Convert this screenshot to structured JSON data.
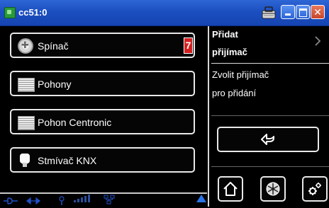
{
  "window": {
    "title": "cc51:0",
    "icons": [
      "app-icon",
      "toolbox-icon",
      "minimize-icon",
      "maximize-icon",
      "close-icon"
    ],
    "close_glyph": "✕"
  },
  "device_list": {
    "items": [
      {
        "label": "Spínač",
        "icon": "switch-icon",
        "badge": "7"
      },
      {
        "label": "Pohony",
        "icon": "blind-icon"
      },
      {
        "label": "Pohon Centronic",
        "icon": "blind-icon"
      },
      {
        "label": "Stmívač KNX",
        "icon": "bulb-icon"
      }
    ]
  },
  "status_bar": {
    "icons": [
      "plug-icon",
      "sync-icon",
      "antenna-icon",
      "signal-strength-icon",
      "network-icon"
    ],
    "accent_color": "#1f50c8"
  },
  "side_panel": {
    "title_line1": "Přidat",
    "title_line2": "přijímač",
    "description_line1": "Zvolit přijímač",
    "description_line2": "pro přidání",
    "buttons": [
      "back-icon",
      "home-icon",
      "fan-icon",
      "settings-icon"
    ]
  },
  "colors": {
    "titlebar": "#1b4fc0",
    "background": "#000000",
    "badge": "#d42020",
    "button_border": "#e8e8e8"
  }
}
